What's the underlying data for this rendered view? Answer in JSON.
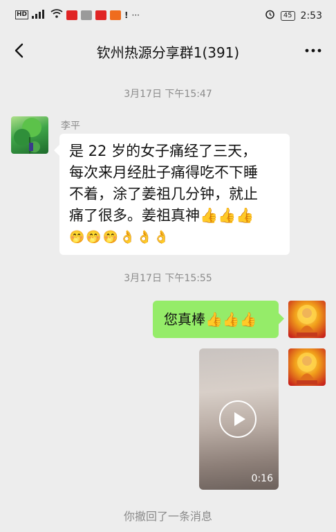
{
  "status_bar": {
    "network": "HD",
    "signal": "5G",
    "battery": "45",
    "time": "2:53"
  },
  "header": {
    "title": "钦州热源分享群1(391)",
    "back_icon": "chevron-left-icon",
    "more_icon": "more-icon"
  },
  "messages": [
    {
      "timestamp": "3月17日 下午15:47",
      "sender": "李平",
      "text_lines": [
        "是 22 岁的女子痛经了三天，",
        "每次来月经肚子痛得吃不下睡",
        "不着，涂了姜祖几分钟，就止",
        "痛了很多。姜祖真神👍👍👍"
      ],
      "emoji_line": "🤭🤭🤭👌👌👌"
    },
    {
      "timestamp": "3月17日 下午15:55",
      "text": "您真棒👍👍👍"
    },
    {
      "video_duration": "0:16"
    }
  ],
  "recall_notice": "你撤回了一条消息"
}
